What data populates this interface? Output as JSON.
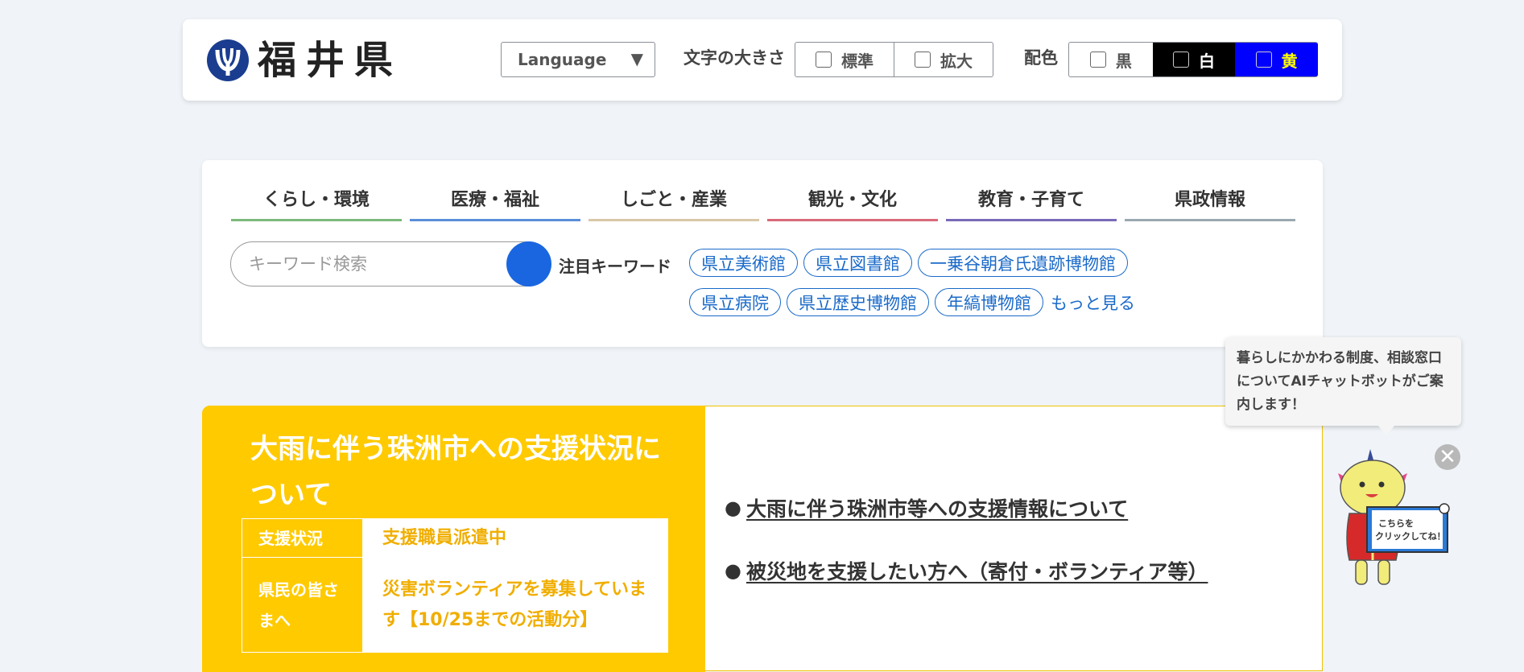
{
  "header": {
    "logo_text": "福井県",
    "language_label": "Language",
    "language_arrow": "▼",
    "font_size_label": "文字の大きさ",
    "font_size_options": [
      "標準",
      "拡大"
    ],
    "color_label": "配色",
    "color_options": [
      "黒",
      "白",
      "黄"
    ]
  },
  "nav": {
    "menu": [
      {
        "label": "くらし・環境",
        "color": "#7cba7c"
      },
      {
        "label": "医療・福祉",
        "color": "#5a8fd8"
      },
      {
        "label": "しごと・産業",
        "color": "#d8c8a8"
      },
      {
        "label": "観光・文化",
        "color": "#d86a7a"
      },
      {
        "label": "教育・子育て",
        "color": "#7a6ab8"
      },
      {
        "label": "県政情報",
        "color": "#9aa8b0"
      }
    ],
    "search_placeholder": "キーワード検索",
    "keywords_label": "注目キーワード",
    "keywords_row1": [
      "県立美術館",
      "県立図書館",
      "一乗谷朝倉氏遺跡博物館"
    ],
    "keywords_row2": [
      "県立病院",
      "県立歴史博物館",
      "年縞博物館"
    ],
    "more_label": "もっと見る"
  },
  "emergency": {
    "title": "大雨に伴う珠洲市への支援状況について",
    "table": [
      {
        "header": "支援状況",
        "value": "支援職員派遣中"
      },
      {
        "header": "県民の皆さまへ",
        "value": "災害ボランティアを募集しています【10/25までの活動分】"
      }
    ],
    "links": [
      "大雨に伴う珠洲市等への支援情報について",
      "被災地を支援したい方へ（寄付・ボランティア等）"
    ],
    "bullet": "●"
  },
  "chatbot": {
    "bubble_text": "暮らしにかかわる制度、相談窓口についてAIチャットボットがご案内します！",
    "sign_line1": "こちらを",
    "sign_line2": "クリックしてね！",
    "close_symbol": "✕"
  },
  "colors": {
    "emergency_yellow": "#ffca00",
    "link_blue": "#1a6ac9",
    "search_blue": "#1a66e0",
    "logo_navy": "#1a3d8f"
  }
}
